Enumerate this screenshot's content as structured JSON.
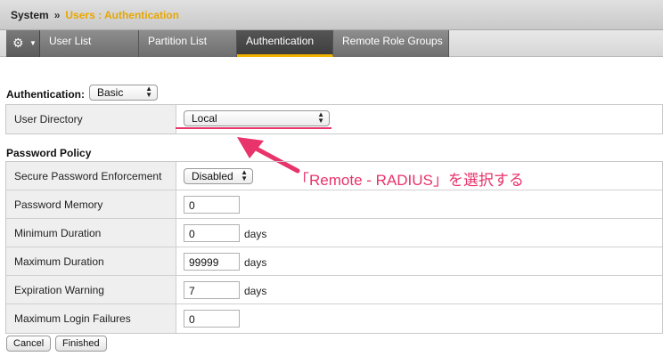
{
  "breadcrumb": {
    "system": "System",
    "separator": "»",
    "current": "Users : Authentication"
  },
  "tabs": [
    {
      "label": "User List"
    },
    {
      "label": "Partition List"
    },
    {
      "label": "Authentication"
    },
    {
      "label": "Remote Role Groups"
    }
  ],
  "gear_menu": {
    "icon": "gear-icon",
    "glyph": "⚙",
    "caret": "▼"
  },
  "authentication": {
    "label": "Authentication:",
    "type_value": "Basic"
  },
  "user_directory": {
    "label": "User Directory",
    "value": "Local"
  },
  "password_policy": {
    "title": "Password Policy",
    "rows": [
      {
        "label": "Secure Password Enforcement",
        "value": "Disabled",
        "unit": ""
      },
      {
        "label": "Password Memory",
        "value": "0",
        "unit": ""
      },
      {
        "label": "Minimum Duration",
        "value": "0",
        "unit": "days"
      },
      {
        "label": "Maximum Duration",
        "value": "99999",
        "unit": "days"
      },
      {
        "label": "Expiration Warning",
        "value": "7",
        "unit": "days"
      },
      {
        "label": "Maximum Login Failures",
        "value": "0",
        "unit": ""
      }
    ]
  },
  "annotation": {
    "text": "「Remote - RADIUS」を選択する",
    "color": "#e8336b"
  },
  "buttons": {
    "cancel": "Cancel",
    "finished": "Finished"
  },
  "colors": {
    "accent": "#f2b200",
    "annotation": "#e8336b"
  }
}
